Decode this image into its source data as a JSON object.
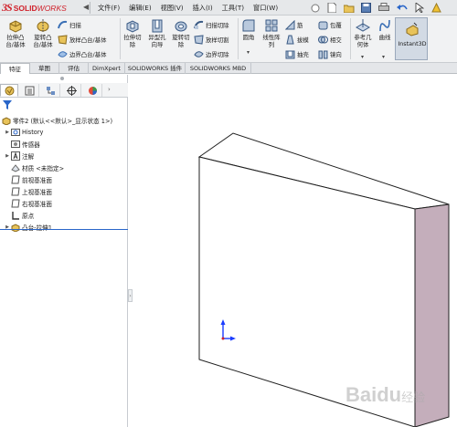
{
  "app": {
    "logo_ds": "3S",
    "logo_text": "SOLID",
    "logo_text_italic": "WORKS"
  },
  "menu": [
    {
      "label": "文件(F)"
    },
    {
      "label": "编辑(E)"
    },
    {
      "label": "视图(V)"
    },
    {
      "label": "插入(I)"
    },
    {
      "label": "工具(T)"
    },
    {
      "label": "窗口(W)"
    }
  ],
  "ribbon": {
    "extrude_boss": "拉伸凸\n台/基体",
    "revolve_boss": "旋转凸\n台/基体",
    "sweep": "扫描",
    "loft_boss": "放样凸台/基体",
    "boundary_boss": "边界凸台/基体",
    "extrude_cut": "拉伸切\n除",
    "hole_wizard": "异型孔\n向导",
    "revolve_cut": "旋转切\n除",
    "swept_cut": "扫描切除",
    "lofted_cut": "放样切割",
    "boundary_cut": "边界切除",
    "fillet": "圆角",
    "linear_pattern": "线性阵\n列",
    "rib": "筋",
    "draft": "拔模",
    "shell": "抽壳",
    "wrap": "包覆",
    "intersect": "相交",
    "mirror": "镜向",
    "ref_geometry": "参考几\n何体",
    "curves": "曲线",
    "instant3d": "Instant3D"
  },
  "tabs": [
    {
      "label": "特征",
      "active": true
    },
    {
      "label": "草图"
    },
    {
      "label": "评估"
    },
    {
      "label": "DimXpert"
    },
    {
      "label": "SOLIDWORKS 插件"
    },
    {
      "label": "SOLIDWORKS MBD"
    }
  ],
  "feature_tree": {
    "part": "零件2 (默认<<默认>_显示状态 1>)",
    "items": [
      {
        "label": "History",
        "expandable": true
      },
      {
        "label": "传感器",
        "expandable": false
      },
      {
        "label": "注解",
        "expandable": true
      },
      {
        "label": "材质 <未指定>",
        "expandable": false
      },
      {
        "label": "前视基准面",
        "expandable": false
      },
      {
        "label": "上视基准面",
        "expandable": false
      },
      {
        "label": "右视基准面",
        "expandable": false
      },
      {
        "label": "原点",
        "expandable": false
      },
      {
        "label": "凸台-拉伸1",
        "expandable": true
      }
    ]
  },
  "watermark": {
    "text": "Baidu",
    "suffix": "经验"
  },
  "colors": {
    "model_front": "#ffffff",
    "model_side": "#c4aebb",
    "model_edge": "#1f1f1f",
    "accent_red": "#d0202a",
    "selection_blue": "#2a66c9"
  }
}
